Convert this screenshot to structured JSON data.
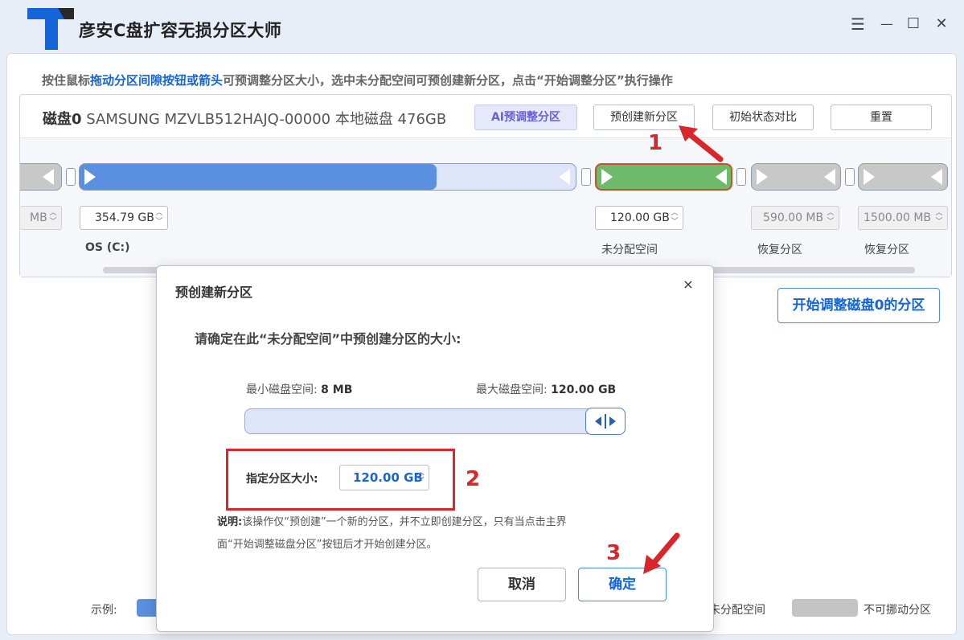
{
  "app": {
    "title": "彦安C盘扩容无损分区大师",
    "logo_letter": "T"
  },
  "window_controls": {
    "menu": "☰",
    "minimize": "—",
    "maximize": "☐",
    "close": "✕"
  },
  "instruction": {
    "prefix": "按住鼠标",
    "highlight": "拖动分区间隙按钮或箭头",
    "suffix": "可预调整分区大小，选中未分配空间可预创建新分区，点击“开始调整分区”执行操作"
  },
  "disk": {
    "name": "磁盘0",
    "info": "SAMSUNG MZVLB512HAJQ-00000 本地磁盘 476GB",
    "buttons": {
      "ai": "AI预调整分区",
      "precreate": "预创建新分区",
      "compare": "初始状态对比",
      "reset": "重置"
    }
  },
  "partitions": [
    {
      "size": "MB",
      "label": ""
    },
    {
      "size": "354.79 GB",
      "label": "OS (C:)",
      "fill_fraction": 0.72
    },
    {
      "size": "120.00 GB",
      "label": "未分配空间"
    },
    {
      "size": "590.00 MB",
      "label": "恢复分区"
    },
    {
      "size": "1500.00 MB",
      "label": "恢复分区"
    }
  ],
  "start_button": "开始调整磁盘0的分区",
  "legend": {
    "label": "示例:",
    "unallocated": "未分配空间",
    "immovable": "不可挪动分区"
  },
  "markers": {
    "one": "1",
    "two": "2",
    "three": "3"
  },
  "dialog": {
    "title": "预创建新分区",
    "close": "×",
    "question": "请确定在此“未分配空间”中预创建分区的大小:",
    "min_label": "最小磁盘空间:",
    "min_value": "8 MB",
    "max_label": "最大磁盘空间:",
    "max_value": "120.00  GB",
    "slider_fraction": 1.0,
    "size_label": "指定分区大小:",
    "size_value": "120.00 GB",
    "note_label": "说明:",
    "note_line1": "该操作仅“预创建”一个新的分区，并不立即创建分区，只有当点击主界",
    "note_line2": "面“开始调整磁盘分区”按钮后才开始创建分区。",
    "cancel": "取消",
    "confirm": "确定"
  },
  "colors": {
    "primary_blue": "#1565d8",
    "partition_blue": "#5b8fe0",
    "unallocated_green": "#6fba6a",
    "immovable_gray": "#c4c4c4",
    "marker_red": "#d8262a"
  }
}
